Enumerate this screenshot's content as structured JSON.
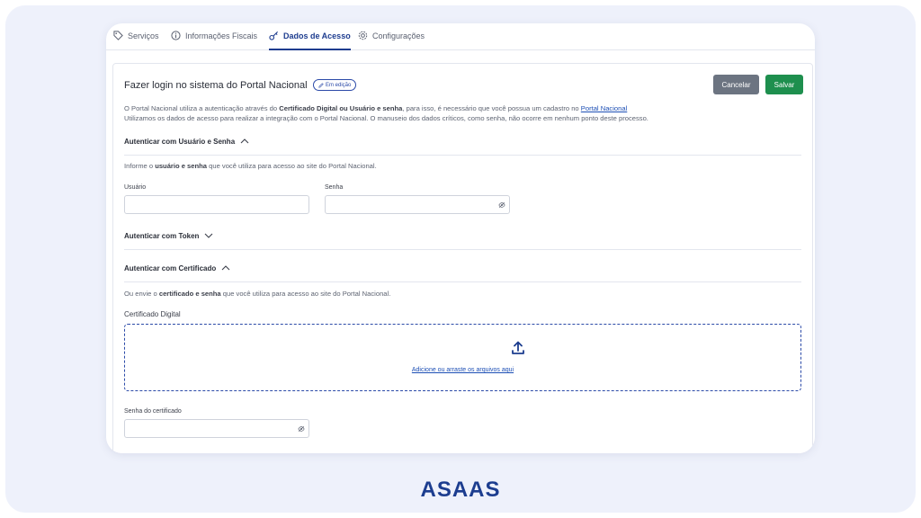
{
  "tabs": [
    {
      "label": "Serviços",
      "icon": "tag-icon"
    },
    {
      "label": "Informações Fiscais",
      "icon": "info-icon"
    },
    {
      "label": "Dados de Acesso",
      "icon": "key-icon",
      "active": true
    },
    {
      "label": "Configurações",
      "icon": "gear-icon"
    }
  ],
  "header": {
    "title": "Fazer login no sistema do Portal Nacional",
    "badge": "Em edição",
    "cancel_label": "Cancelar",
    "save_label": "Salvar"
  },
  "description": {
    "line1_a": "O Portal Nacional utiliza a autenticação através do ",
    "line1_b": "Certificado Digital ou Usuário e senha",
    "line1_c": ", para isso, é necessário que você possua um cadastro no ",
    "line1_link": "Portal Nacional",
    "line2": "Utilizamos os dados de acesso para realizar a integração com o Portal Nacional. O manuseio dos dados críticos, como senha, não ocorre em nenhum ponto deste processo."
  },
  "section_user": {
    "title": "Autenticar com Usuário e Senha",
    "hint_a": "Informe o ",
    "hint_b": "usuário e senha",
    "hint_c": " que você utiliza para acesso ao site do Portal Nacional.",
    "user_label": "Usuário",
    "user_value": "",
    "pass_label": "Senha",
    "pass_value": ""
  },
  "section_token": {
    "title": "Autenticar com Token"
  },
  "section_cert": {
    "title": "Autenticar com Certificado",
    "hint_a": "Ou envie o ",
    "hint_b": "certificado e senha",
    "hint_c": " que você utiliza para acesso ao site do Portal Nacional.",
    "cert_label": "Certificado Digital",
    "upload_text": "Adicione ou arraste os arquivos aqui",
    "cert_pass_label": "Senha do certificado",
    "cert_pass_value": ""
  },
  "brand": {
    "name": "ASAAS",
    "color": "#1c3d8f"
  },
  "colors": {
    "accent": "#1d3c8f",
    "save": "#1e8f4e",
    "cancel": "#6c7481"
  }
}
